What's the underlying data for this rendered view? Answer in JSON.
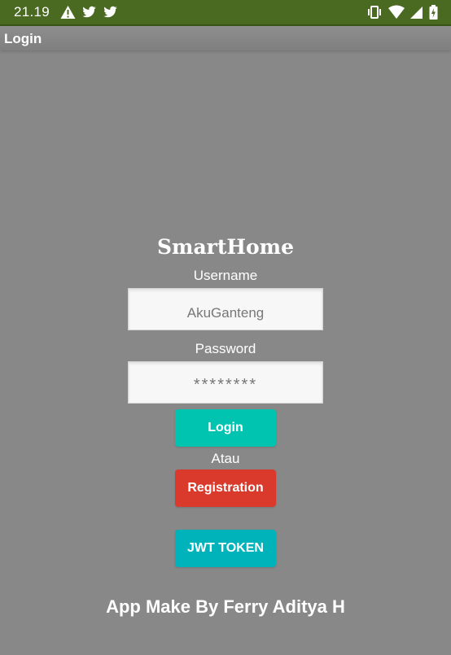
{
  "status_bar": {
    "time": "21.19",
    "left_icons": [
      "warning-icon",
      "twitter-icon",
      "twitter-icon"
    ],
    "right_icons": [
      "vibrate-icon",
      "wifi-icon",
      "cell-signal-icon",
      "battery-icon"
    ]
  },
  "app_bar": {
    "title": "Login"
  },
  "form": {
    "app_title": "SmartHome",
    "username_label": "Username",
    "username_value": "AkuGanteng",
    "password_label": "Password",
    "password_value": "********",
    "login_button": "Login",
    "separator_text": "Atau",
    "registration_button": "Registration",
    "jwt_button": "JWT TOKEN"
  },
  "footer": {
    "credit": "App Make By Ferry Aditya H"
  },
  "colors": {
    "status_bar_bg": "#4a6a21",
    "background": "#888888",
    "login_button": "#00c4b0",
    "registration_button": "#d93a2c",
    "jwt_button": "#00b3bb"
  }
}
